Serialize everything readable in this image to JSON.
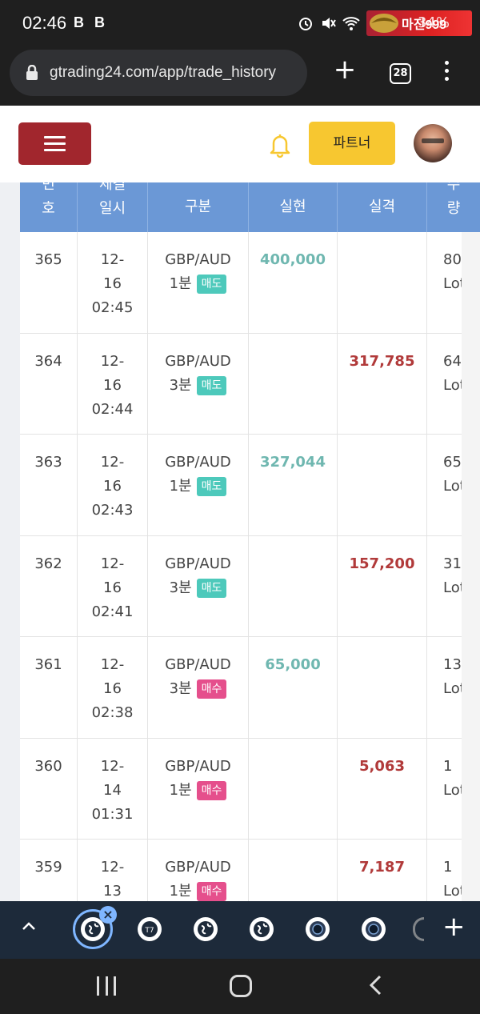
{
  "status_bar": {
    "time": "02:46",
    "notif_badges": [
      "B",
      "B"
    ],
    "battery_text": "34%",
    "brand_logo_text": "마진999"
  },
  "browser": {
    "url": "gtrading24.com/app/trade_history",
    "tab_count": "28"
  },
  "header": {
    "partner_label": "파트너"
  },
  "table": {
    "columns": [
      {
        "top": "번",
        "bottom": "호"
      },
      {
        "top": "체결",
        "bottom": "일시"
      },
      {
        "top": "",
        "bottom": "구분"
      },
      {
        "top": "",
        "bottom": "실현"
      },
      {
        "top": "",
        "bottom": "실격"
      },
      {
        "top": "수",
        "bottom": "량"
      }
    ],
    "rows": [
      {
        "no": "365",
        "date": [
          "12-",
          "16",
          "02:45"
        ],
        "pair": "GBP/AUD",
        "period": "1분",
        "side": "매도",
        "side_type": "sell",
        "realized": "400,000",
        "loss": "",
        "qty": [
          "80",
          "Lot"
        ]
      },
      {
        "no": "364",
        "date": [
          "12-",
          "16",
          "02:44"
        ],
        "pair": "GBP/AUD",
        "period": "3분",
        "side": "매도",
        "side_type": "sell",
        "realized": "",
        "loss": "317,785",
        "qty": [
          "64",
          "Lot"
        ]
      },
      {
        "no": "363",
        "date": [
          "12-",
          "16",
          "02:43"
        ],
        "pair": "GBP/AUD",
        "period": "1분",
        "side": "매도",
        "side_type": "sell",
        "realized": "327,044",
        "loss": "",
        "qty": [
          "65",
          "Lot"
        ]
      },
      {
        "no": "362",
        "date": [
          "12-",
          "16",
          "02:41"
        ],
        "pair": "GBP/AUD",
        "period": "3분",
        "side": "매도",
        "side_type": "sell",
        "realized": "",
        "loss": "157,200",
        "qty": [
          "31",
          "Lot"
        ]
      },
      {
        "no": "361",
        "date": [
          "12-",
          "16",
          "02:38"
        ],
        "pair": "GBP/AUD",
        "period": "3분",
        "side": "매수",
        "side_type": "buy",
        "realized": "65,000",
        "loss": "",
        "qty": [
          "13",
          "Lot"
        ]
      },
      {
        "no": "360",
        "date": [
          "12-",
          "14",
          "01:31"
        ],
        "pair": "GBP/AUD",
        "period": "1분",
        "side": "매수",
        "side_type": "buy",
        "realized": "",
        "loss": "5,063",
        "qty": [
          "1",
          "Lot"
        ]
      },
      {
        "no": "359",
        "date": [
          "12-",
          "13",
          ""
        ],
        "pair": "GBP/AUD",
        "period": "1분",
        "side": "매수",
        "side_type": "buy",
        "realized": "",
        "loss": "7,187",
        "qty": [
          "1",
          "Lot"
        ]
      }
    ]
  },
  "colors": {
    "header_blue": "#6b98d6",
    "menu_red": "#a1262d",
    "partner_yellow": "#f7c730",
    "profit": "#6fb7b0",
    "loss": "#b13a3a",
    "sell_badge": "#4dc9bb",
    "buy_badge": "#e54f8c"
  },
  "icons": {
    "lock": "lock-icon",
    "bell": "bell-icon",
    "menu": "hamburger-icon",
    "tab_icons": [
      "globe-icon",
      "app-icon",
      "globe-icon",
      "globe-icon",
      "camera-icon",
      "camera-icon"
    ]
  }
}
